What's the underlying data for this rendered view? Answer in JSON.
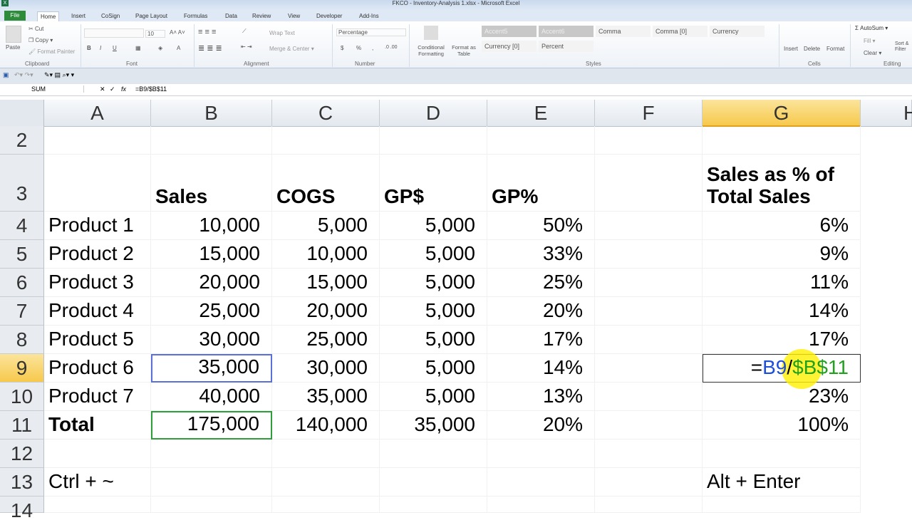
{
  "window": {
    "title": "FKCO - Inventory-Analysis 1.xlsx  -  Microsoft Excel",
    "app_icon": "X"
  },
  "tabs": [
    "File",
    "Home",
    "Insert",
    "CoSign",
    "Page Layout",
    "Formulas",
    "Data",
    "Review",
    "View",
    "Developer",
    "Add-Ins"
  ],
  "ribbon": {
    "clipboard": {
      "paste": "Paste",
      "cut": "Cut",
      "copy": "Copy ▾",
      "format_painter": "Format Painter",
      "label": "Clipboard"
    },
    "font": {
      "size": "10",
      "bold": "B",
      "italic": "I",
      "underline": "U",
      "label": "Font"
    },
    "alignment": {
      "wrap": "Wrap Text",
      "merge": "Merge & Center ▾",
      "label": "Alignment"
    },
    "number": {
      "format": "Percentage",
      "currency": "$",
      "percent": "%",
      "comma": ",",
      "label": "Number"
    },
    "styles": {
      "cond": "Conditional Formatting",
      "table": "Format as Table",
      "cells": [
        "Accent5",
        "Accent6",
        "Comma",
        "Comma [0]",
        "Currency",
        "Currency [0]",
        "Percent"
      ],
      "label": "Styles"
    },
    "cells": {
      "insert": "Insert",
      "delete": "Delete",
      "format": "Format",
      "label": "Cells"
    },
    "editing": {
      "autosum": "Σ AutoSum ▾",
      "fill": "Fill ▾",
      "clear": "Clear ▾",
      "sort": "Sort & Filter",
      "label": "Editing"
    }
  },
  "formula_bar": {
    "name_box": "SUM",
    "formula": "=B9/$B$11",
    "fx": "fx",
    "cancel": "✕",
    "enter": "✓"
  },
  "columns": [
    "A",
    "B",
    "C",
    "D",
    "E",
    "F",
    "G",
    "H"
  ],
  "rows": [
    {
      "n": "2",
      "cells": [
        "",
        "",
        "",
        "",
        "",
        "",
        ""
      ]
    },
    {
      "n": "3",
      "cells": [
        "",
        "Sales",
        "COGS",
        "GP$",
        "GP%",
        "",
        "Sales as % of\nTotal Sales"
      ]
    },
    {
      "n": "4",
      "cells": [
        "Product 1",
        "10,000",
        "5,000",
        "5,000",
        "50%",
        "",
        "6%"
      ]
    },
    {
      "n": "5",
      "cells": [
        "Product 2",
        "15,000",
        "10,000",
        "5,000",
        "33%",
        "",
        "9%"
      ]
    },
    {
      "n": "6",
      "cells": [
        "Product 3",
        "20,000",
        "15,000",
        "5,000",
        "25%",
        "",
        "11%"
      ]
    },
    {
      "n": "7",
      "cells": [
        "Product 4",
        "25,000",
        "20,000",
        "5,000",
        "20%",
        "",
        "14%"
      ]
    },
    {
      "n": "8",
      "cells": [
        "Product 5",
        "30,000",
        "25,000",
        "5,000",
        "17%",
        "",
        "17%"
      ]
    },
    {
      "n": "9",
      "cells": [
        "Product 6",
        "35,000",
        "30,000",
        "5,000",
        "14%",
        "",
        ""
      ]
    },
    {
      "n": "10",
      "cells": [
        "Product 7",
        "40,000",
        "35,000",
        "5,000",
        "13%",
        "",
        "23%"
      ]
    },
    {
      "n": "11",
      "cells": [
        "Total",
        "175,000",
        "140,000",
        "35,000",
        "20%",
        "",
        "100%"
      ]
    },
    {
      "n": "12",
      "cells": [
        "",
        "",
        "",
        "",
        "",
        "",
        ""
      ]
    },
    {
      "n": "13",
      "cells": [
        "Ctrl + ~",
        "",
        "",
        "",
        "",
        "",
        "Alt + Enter"
      ]
    },
    {
      "n": "14",
      "cells": [
        "",
        "",
        "",
        "",
        "",
        "",
        ""
      ]
    }
  ],
  "edit_cell": {
    "parts": [
      "=",
      "B9",
      "/",
      "$B$11"
    ],
    "colors": [
      "#000000",
      "#1f4fd8",
      "#000000",
      "#22a020"
    ]
  }
}
